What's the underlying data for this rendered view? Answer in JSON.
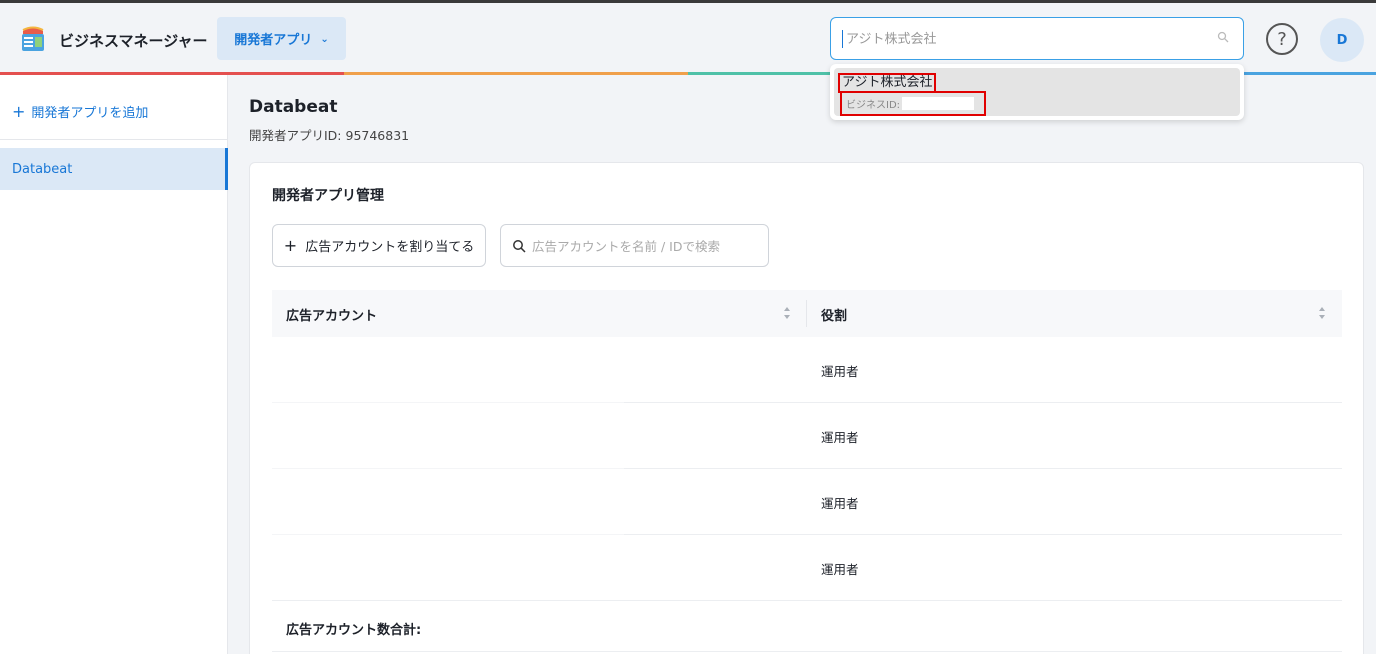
{
  "header": {
    "app_title": "ビジネスマネージャー",
    "app_selector_label": "開発者アプリ",
    "search_value": "アジト株式会社",
    "help_label": "?",
    "avatar_initial": "D"
  },
  "dropdown": {
    "option_name": "アジト株式会社",
    "option_id_label": "ビジネスID:"
  },
  "sidebar": {
    "add_label": "開発者アプリを追加",
    "items": [
      {
        "label": "Databeat",
        "active": true
      }
    ]
  },
  "page": {
    "title": "Databeat",
    "subtitle": "開発者アプリID: 95746831"
  },
  "card": {
    "title": "開発者アプリ管理",
    "assign_button": "広告アカウントを割り当てる",
    "search_placeholder": "広告アカウントを名前 / IDで検索",
    "columns": [
      "広告アカウント",
      "役割"
    ],
    "rows": [
      {
        "account": "",
        "role": "運用者"
      },
      {
        "account": "",
        "role": "運用者"
      },
      {
        "account": "",
        "role": "運用者"
      },
      {
        "account": "",
        "role": "運用者"
      }
    ],
    "total_label": "広告アカウント数合計:"
  },
  "colors": {
    "accent": "#1877d6",
    "accent_bg": "#dbe8f6",
    "highlight_box": "#e00000",
    "rainbow": [
      "#e4504f",
      "#f0a04b",
      "#4fc1a8",
      "#4aa3e0"
    ]
  }
}
